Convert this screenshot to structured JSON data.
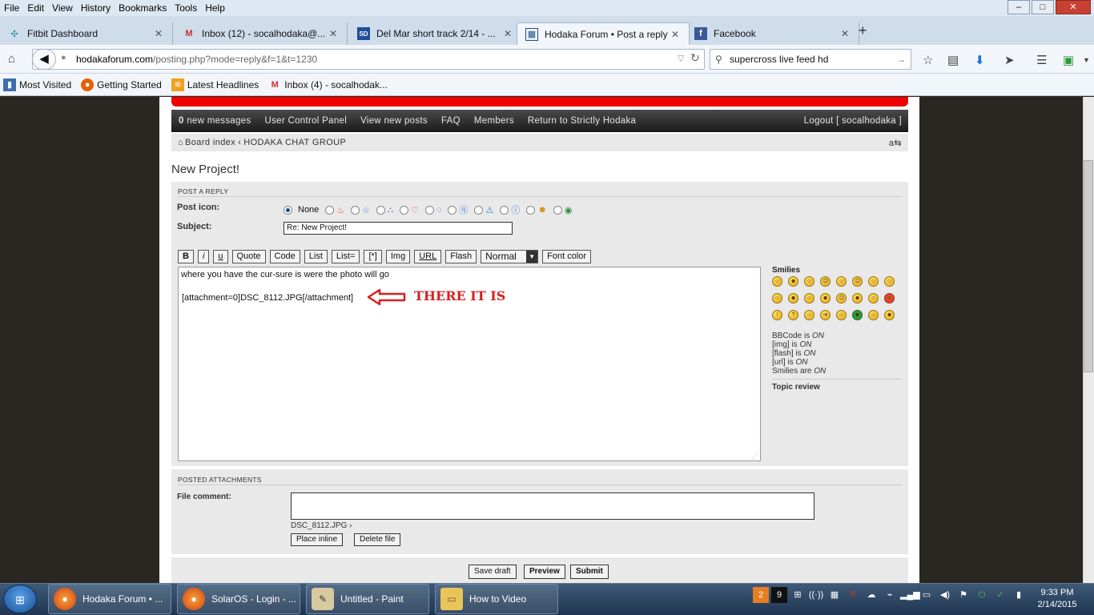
{
  "menubar": {
    "items": [
      "File",
      "Edit",
      "View",
      "History",
      "Bookmarks",
      "Tools",
      "Help"
    ]
  },
  "window": {
    "minimize": "–",
    "maximize": "□",
    "close": "✕"
  },
  "tabs": [
    {
      "label": "Fitbit Dashboard",
      "icon": "fitbit-icon"
    },
    {
      "label": "Inbox (12) - socalhodaka@...",
      "icon": "gmail-icon"
    },
    {
      "label": "Del Mar short track 2/14 - ...",
      "icon": "site-icon"
    },
    {
      "label": "Hodaka Forum • Post a reply",
      "icon": "forum-icon"
    },
    {
      "label": "Facebook",
      "icon": "facebook-icon"
    }
  ],
  "nav": {
    "url_host": "hodakaforum.com",
    "url_path": "/posting.php?mode=reply&f=1&t=1230",
    "search": "supercross live feed hd"
  },
  "bookmarks": [
    {
      "label": "Most Visited",
      "icon": "bookmark-icon"
    },
    {
      "label": "Getting Started",
      "icon": "firefox-icon"
    },
    {
      "label": "Latest Headlines",
      "icon": "rss-icon"
    },
    {
      "label": "Inbox (4) - socalhodak...",
      "icon": "gmail-icon"
    }
  ],
  "forumnav": {
    "newmsg_count": "0",
    "newmsg_label": "new messages",
    "ucp": "User Control Panel",
    "newposts": "View new posts",
    "faq": "FAQ",
    "members": "Members",
    "return": "Return to Strictly Hodaka",
    "logout": "Logout [ socalhodaka ]"
  },
  "breadcrumb": {
    "index": "Board index",
    "sep": "‹",
    "forum": "HODAKA CHAT GROUP"
  },
  "topic_title": "New Project!",
  "post": {
    "section": "POST A REPLY",
    "icon_label": "Post icon:",
    "icon_none": "None",
    "subject_label": "Subject:",
    "subject_value": "Re: New Project!",
    "toolbar": {
      "b": "B",
      "i": "i",
      "u": "u",
      "quote": "Quote",
      "code": "Code",
      "list": "List",
      "list_eq": "List=",
      "star": "[*]",
      "img": "Img",
      "url": "URL",
      "flash": "Flash",
      "size": "Normal",
      "color": "Font color"
    },
    "message_line1": "where you have the cur-sure is were the photo will go",
    "message_line2": "[attachment=0]DSC_8112.JPG[/attachment]"
  },
  "annotation": {
    "text": "THERE IT IS",
    "color": "#d62020"
  },
  "smilies": {
    "title": "Smilies",
    "count": 24
  },
  "status": {
    "bbcode": "BBCode is",
    "img": "[img] is",
    "flash": "[flash] is",
    "url": "[url] is",
    "smilies": "Smilies are",
    "on": "ON",
    "topic_review": "Topic review"
  },
  "attachments": {
    "section": "POSTED ATTACHMENTS",
    "file_comment": "File comment:",
    "filename": "DSC_8112.JPG",
    "place_inline": "Place inline",
    "delete": "Delete file"
  },
  "actions": {
    "save_draft": "Save draft",
    "preview": "Preview",
    "submit": "Submit"
  },
  "taskbar": [
    {
      "label": "Hodaka Forum • ...",
      "icon": "firefox-icon"
    },
    {
      "label": "SolarOS - Login - ...",
      "icon": "firefox-icon"
    },
    {
      "label": "Untitled - Paint",
      "icon": "paint-icon"
    },
    {
      "label": "How to Video",
      "icon": "folder-icon"
    }
  ],
  "clock": {
    "time": "9:33 PM",
    "date": "2/14/2015"
  },
  "colors": {
    "red_header": "#e00000",
    "forum_bar": "#1a1a1a",
    "panel": "#e9e9e9"
  }
}
